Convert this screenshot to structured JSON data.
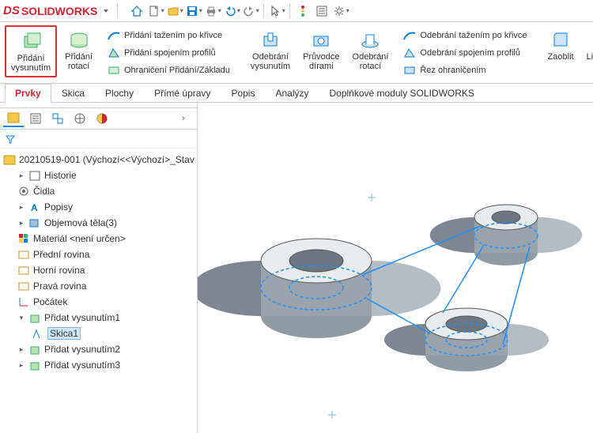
{
  "app": {
    "name": "SOLIDWORKS"
  },
  "ribbon": {
    "pridani_vysunutim": "Přidání\nvysunutím",
    "pridani_rotaci": "Přidání\nrotací",
    "tazeni_krivka": "Přidání tažením po křivce",
    "spojeni_profilu": "Přidání spojením profilů",
    "ohraniceni_pridani": "Ohraničení Přidání/Základu",
    "odebrani_vysunutim": "Odebrání\nvysunutím",
    "pruvodce_dirami": "Průvodce\ndírami",
    "odebrani_rotaci": "Odebrání\nrotací",
    "odebrani_tazenim": "Odebrání tažením po křivce",
    "odebrani_spojenim": "Odebrání spojením profilů",
    "rez_ohranicenim": "Řez ohraničením",
    "zaoblit": "Zaoblit",
    "linearni_pole": "Lineární\npole"
  },
  "tabs": {
    "prvky": "Prvky",
    "skica": "Skica",
    "plochy": "Plochy",
    "prime_upravy": "Přímé úpravy",
    "popis": "Popis",
    "analyzy": "Analýzy",
    "doplnkove": "Doplňkové moduly SOLIDWORKS"
  },
  "tree": {
    "root": "20210519-001  (Výchozí<<Výchozí>_Stav",
    "historie": "Historie",
    "cidla": "Čidla",
    "popisy": "Popisy",
    "objemova_tela": "Objemová těla(3)",
    "material": "Materiál <není určen>",
    "predni_rovina": "Přední rovina",
    "horni_rovina": "Horní rovina",
    "prava_rovina": "Pravá rovina",
    "pocatek": "Počátek",
    "extrude1": "Přidat vysunutím1",
    "sketch1": "Skica1",
    "extrude2": "Přidat vysunutím2",
    "extrude3": "Přidat vysunutím3"
  }
}
